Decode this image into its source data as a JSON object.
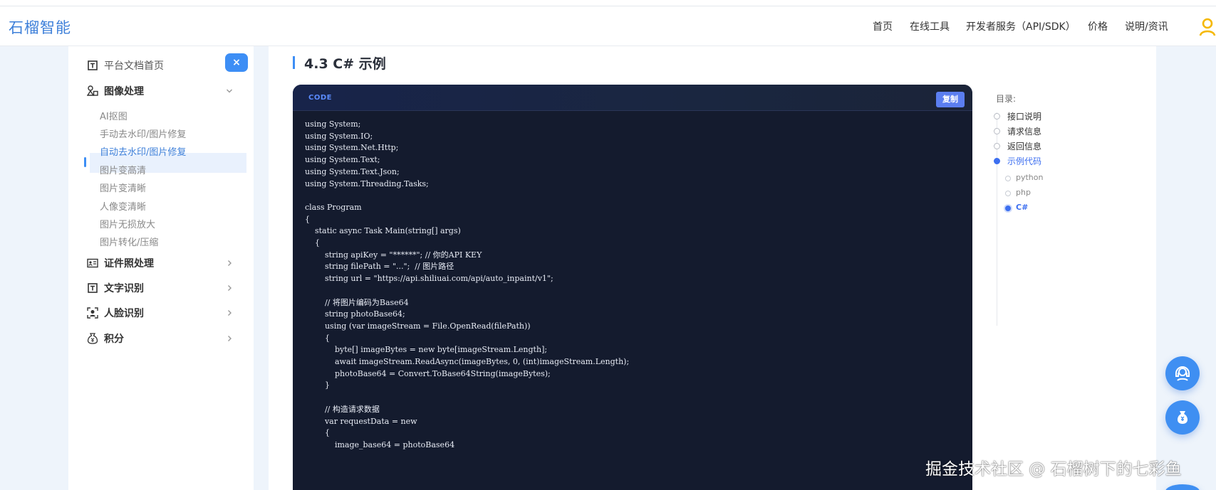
{
  "header": {
    "brand": "石榴智能",
    "nav": [
      "首页",
      "在线工具",
      "开发者服务（API/SDK）",
      "价格",
      "说明/资讯"
    ]
  },
  "sidebar": {
    "close_label": "×",
    "home": "平台文档首页",
    "groups": [
      {
        "label": "图像处理",
        "expanded": true
      },
      {
        "label": "证件照处理",
        "expanded": false
      },
      {
        "label": "文字识别",
        "expanded": false
      },
      {
        "label": "人脸识别",
        "expanded": false
      },
      {
        "label": "积分",
        "expanded": false
      }
    ],
    "image_items": [
      "AI抠图",
      "手动去水印/图片修复",
      "自动去水印/图片修复",
      "图片变高清",
      "图片变清晰",
      "人像变清晰",
      "图片无损放大",
      "图片转化/压缩"
    ],
    "active_item": "自动去水印/图片修复"
  },
  "main": {
    "section_title": "4.3 C# 示例",
    "code": {
      "label": "CODE",
      "copy_label": "复制",
      "lines": [
        "using System;",
        "using System.IO;",
        "using System.Net.Http;",
        "using System.Text;",
        "using System.Text.Json;",
        "using System.Threading.Tasks;",
        "",
        "class Program",
        "{",
        "    static async Task Main(string[] args)",
        "    {",
        "        string apiKey = \"******\"; // 你的API KEY",
        "        string filePath = \"...\";  // 图片路径",
        "        string url = \"https://api.shiliuai.com/api/auto_inpaint/v1\";",
        "",
        "        // 将图片编码为Base64",
        "        string photoBase64;",
        "        using (var imageStream = File.OpenRead(filePath))",
        "        {",
        "            byte[] imageBytes = new byte[imageStream.Length];",
        "            await imageStream.ReadAsync(imageBytes, 0, (int)imageStream.Length);",
        "            photoBase64 = Convert.ToBase64String(imageBytes);",
        "        }",
        "",
        "        // 构造请求数据",
        "        var requestData = new",
        "        {",
        "            image_base64 = photoBase64"
      ]
    }
  },
  "toc": {
    "title": "目录:",
    "items": [
      "接口说明",
      "请求信息",
      "返回信息",
      "示例代码"
    ],
    "active_item": "示例代码",
    "subitems": [
      "python",
      "php",
      "C#"
    ],
    "active_subitem": "C#"
  },
  "watermark": "掘金技术社区 @ 石榴树下的七彩鱼",
  "colors": {
    "accent": "#3d8ef5",
    "brand": "#3d7fd9",
    "code_bg": "#141b2e",
    "toc_active": "#3d6ff0"
  }
}
